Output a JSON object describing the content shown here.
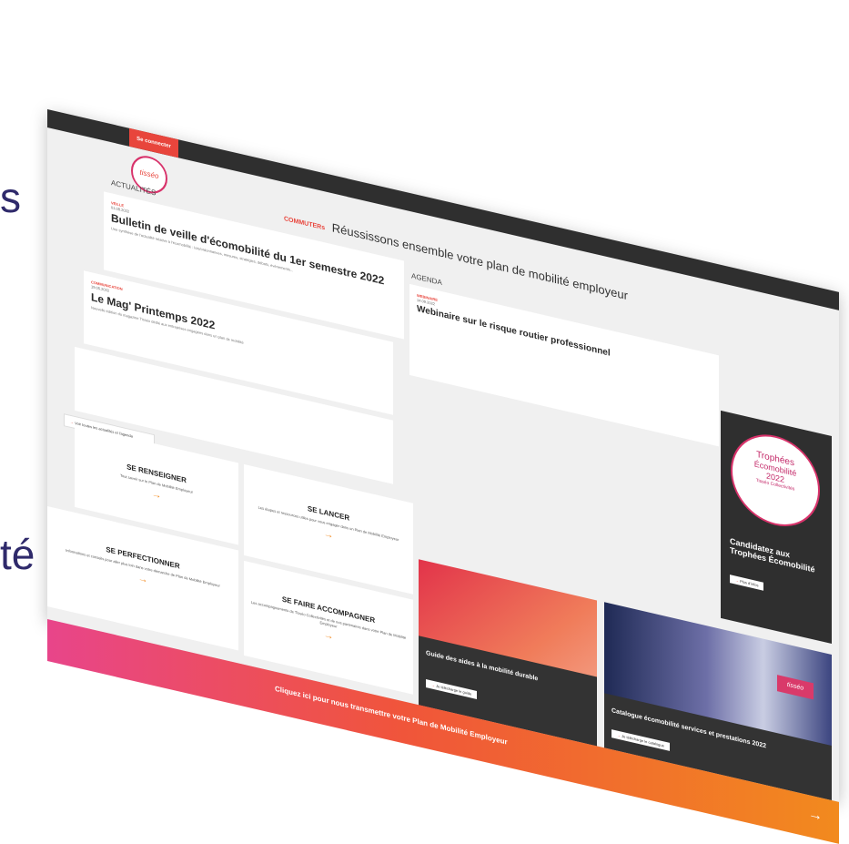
{
  "background": {
    "left_fragment": "s",
    "bottom_fragment": "té"
  },
  "header": {
    "login_label": "Se connecter",
    "logo_text": "tisséo",
    "search_icon": "search-icon"
  },
  "headline": {
    "prefix": "COMMUTERs",
    "title": "Réussissons ensemble votre plan de mobilité employeur"
  },
  "news": {
    "section_title": "ACTUALITÉS",
    "items": [
      {
        "tag": "VEILLE",
        "date": "01.08.2022",
        "title": "Bulletin de veille d'écomobilité du 1er semestre 2022",
        "subtitle": "Une synthèse de l'actualité relative à l'écomobilité : lois/ordonnances, mesures, stratégies, débats, évènements..."
      },
      {
        "tag": "COMMUNICATION",
        "date": "19.05.2022",
        "title": "Le Mag' Printemps 2022",
        "subtitle": "Nouvelle édition du magazine Tisséo dédié aux entreprises engagées dans un plan de mobilité"
      }
    ],
    "all_link": "Voir toutes les actualités et l'agenda"
  },
  "agenda": {
    "section_title": "AGENDA",
    "tag": "WEBINAIRE",
    "date": "14.09.2022",
    "title": "Webinaire sur le risque routier professionnel"
  },
  "steps": [
    {
      "title": "SE RENSEIGNER",
      "subtitle": "Tout savoir sur le Plan de Mobilité Employeur"
    },
    {
      "title": "SE LANCER",
      "subtitle": "Les étapes et ressources utiles pour vous engager dans un Plan de Mobilité Employeur"
    },
    {
      "title": "SE PERFECTIONNER",
      "subtitle": "Informations et conseils pour aller plus loin dans votre démarche de Plan de Mobilité Employeur"
    },
    {
      "title": "SE FAIRE ACCOMPAGNER",
      "subtitle": "Les accompagnements de Tisséo Collectivités et de nos partenaires dans votre Plan de Mobilité Employeur"
    }
  ],
  "guide": {
    "label": "Guide des aides à la mobilité durable",
    "button": "Je télécharge le guide"
  },
  "catalogue": {
    "badge": "tisséo",
    "label": "Catalogue écomobilité services et prestations 2022",
    "button": "Je télécharge le catalogue"
  },
  "trophy": {
    "line1": "Trophées",
    "line2": "Écomobilité",
    "line3": "2022",
    "line4": "Tisséo Collectivités",
    "cta": "Candidatez aux Trophées Écomobilité",
    "button": "Plus d'infos"
  },
  "banner": {
    "text": "Cliquez ici pour nous transmettre votre Plan de Mobilité Employeur",
    "arrow": "→"
  },
  "colors": {
    "accent": "#e8453c",
    "pink": "#d8336b",
    "orange": "#f28a1e",
    "dark": "#2f2f2f",
    "text_bg": "#2f2a6b"
  }
}
